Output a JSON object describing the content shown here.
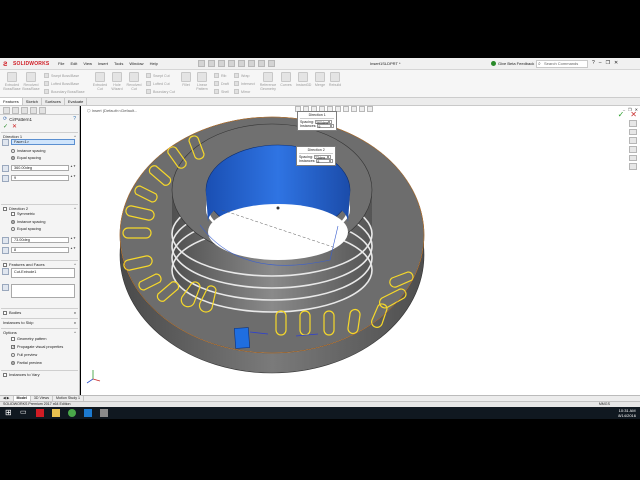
{
  "app": {
    "logo_text": "SOLIDWORKS",
    "document_title": "Insert1SLDPRT *",
    "beta_feedback": "Give Beta Feedback",
    "search_placeholder": "Search Commands"
  },
  "menu": [
    "File",
    "Edit",
    "View",
    "Insert",
    "Tools",
    "Window",
    "Help"
  ],
  "commands": {
    "extruded_boss": "Extruded Boss/Base",
    "revolved_boss": "Revolved Boss/Base",
    "swept_boss": "Swept Boss/Base",
    "lofted_boss": "Lofted Boss/Base",
    "boundary_boss": "Boundary Boss/Base",
    "extruded_cut": "Extruded Cut",
    "hole_wizard": "Hole Wizard",
    "revolved_cut": "Revolved Cut",
    "swept_cut": "Swept Cut",
    "lofted_cut": "Lofted Cut",
    "boundary_cut": "Boundary Cut",
    "fillet": "Fillet",
    "linear_pattern": "Linear Pattern",
    "rib": "Rib",
    "wrap": "Wrap",
    "draft": "Draft",
    "intersect": "Intersect",
    "shell": "Shell",
    "mirror": "Mirror",
    "reference_geometry": "Reference Geometry",
    "curves": "Curves",
    "instant3d": "Instant3D",
    "merge": "Merge",
    "rebuild": "Rebuild"
  },
  "tabs": [
    "Features",
    "Sketch",
    "Surfaces",
    "Evaluate"
  ],
  "property_manager": {
    "title": "CirPattern1",
    "direction1": {
      "header": "Direction 1",
      "axis_field": "Face<1>",
      "instance_spacing": "Instance spacing",
      "equal_spacing": "Equal spacing",
      "angle": "360.00deg",
      "count": "9"
    },
    "direction2": {
      "header": "Direction 2",
      "symmetric": "Symmetric",
      "instance_spacing": "Instance spacing",
      "equal_spacing": "Equal spacing",
      "angle": "73.00deg",
      "count": "8"
    },
    "features_faces": {
      "header": "Features and Faces",
      "feature_item": "Cut-Extrude1"
    },
    "bodies": "Bodies",
    "instances_to_skip": "Instances to Skip",
    "options": {
      "header": "Options",
      "geometry_pattern": "Geometry pattern",
      "propagate": "Propagate visual properties",
      "full_preview": "Full preview",
      "partial_preview": "Partial preview"
    },
    "instances_to_vary": "Instances to Vary"
  },
  "graphics": {
    "breadcrumb": "Insert (Default<<Default...",
    "callout1": {
      "title": "Direction 1",
      "spacing_label": "Spacing:",
      "spacing_value": "360deg",
      "instances_label": "Instances:",
      "instances_value": "9"
    },
    "callout2": {
      "title": "Direction 2",
      "spacing_label": "Spacing:",
      "spacing_value": "73deg",
      "instances_label": "Instances:",
      "instances_value": "8"
    }
  },
  "bottom_tabs": [
    "Model",
    "3D Views",
    "Motion Study 1"
  ],
  "status": {
    "left": "SOLIDWORKS Premium 2017 x64 Edition",
    "right": "MMGS"
  },
  "taskbar": {
    "time": "10:31 AM",
    "date": "8/14/2016"
  },
  "colors": {
    "accent_red": "#d01c24",
    "model_gray": "#6d6d6d",
    "model_blue": "#1f5fc7",
    "highlight_yellow": "#f6d82a"
  }
}
